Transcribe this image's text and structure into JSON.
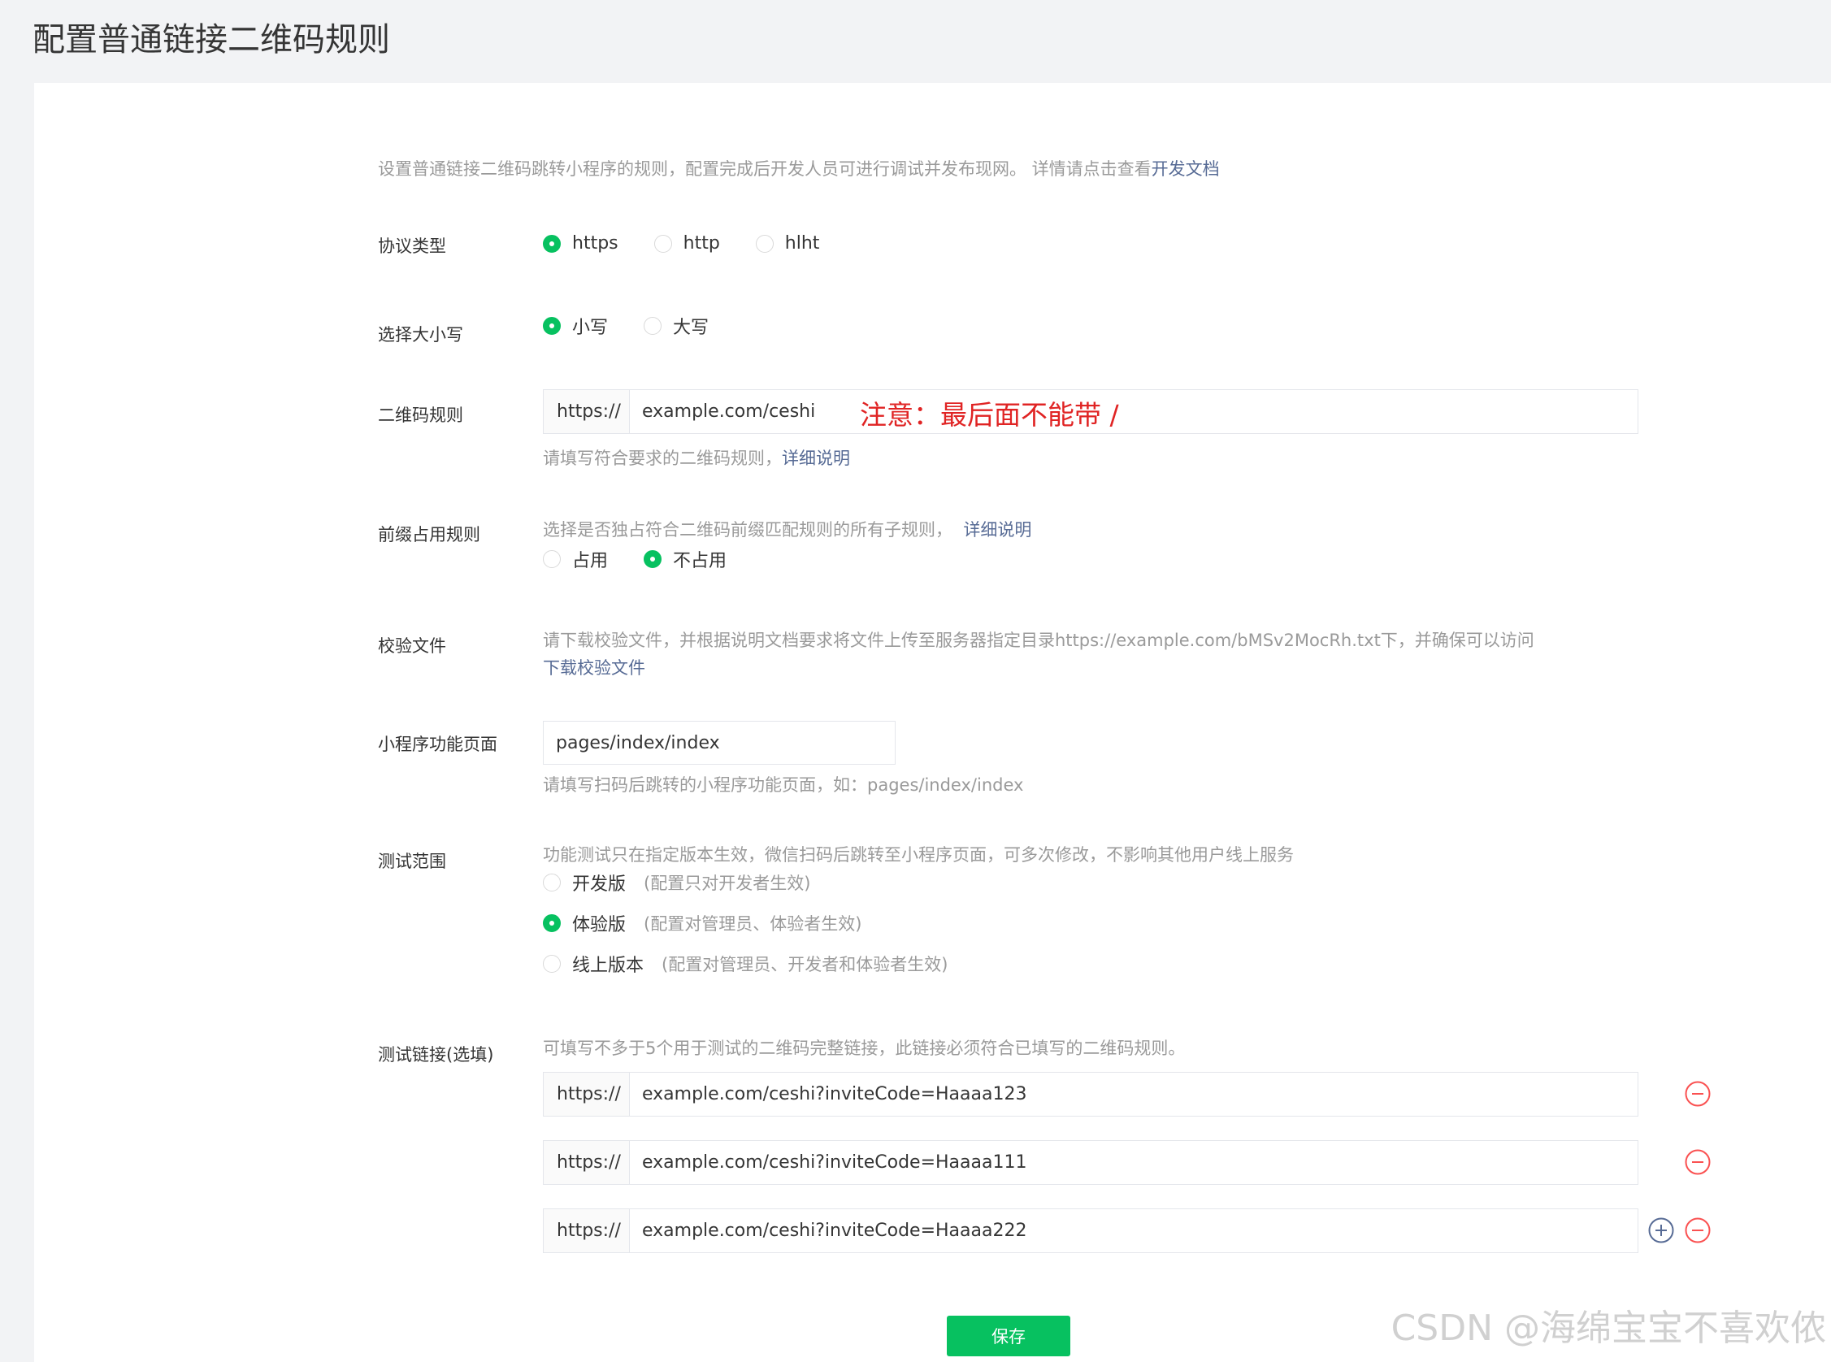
{
  "page_title": "配置普通链接二维码规则",
  "intro": {
    "text": "设置普通链接二维码跳转小程序的规则，配置完成后开发人员可进行调试并发布现网。 详情请点击查看",
    "link": "开发文档"
  },
  "protocol": {
    "label": "协议类型",
    "options": [
      "https",
      "http",
      "hlht"
    ],
    "selected": "https"
  },
  "case": {
    "label": "选择大小写",
    "options": [
      "小写",
      "大写"
    ],
    "selected": "小写"
  },
  "qr_rule": {
    "label": "二维码规则",
    "prefix": "https://",
    "value": "example.com/ceshi",
    "annotation": "注意：最后面不能带 /",
    "hint": "请填写符合要求的二维码规则，",
    "hint_link": "详细说明"
  },
  "prefix_rule": {
    "label": "前缀占用规则",
    "hint": "选择是否独占符合二维码前缀匹配规则的所有子规则，",
    "hint_link": "详细说明",
    "options": [
      "占用",
      "不占用"
    ],
    "selected": "不占用"
  },
  "verify_file": {
    "label": "校验文件",
    "hint": "请下载校验文件，并根据说明文档要求将文件上传至服务器指定目录https://example.com/bMSv2MocRh.txt下，并确保可以访问",
    "download_link": "下载校验文件"
  },
  "mini_page": {
    "label": "小程序功能页面",
    "value": "pages/index/index",
    "hint": "请填写扫码后跳转的小程序功能页面，如：pages/index/index"
  },
  "test_scope": {
    "label": "测试范围",
    "hint": "功能测试只在指定版本生效，微信扫码后跳转至小程序页面，可多次修改，不影响其他用户线上服务",
    "options": [
      {
        "name": "开发版",
        "desc": "(配置只对开发者生效)"
      },
      {
        "name": "体验版",
        "desc": "(配置对管理员、体验者生效)"
      },
      {
        "name": "线上版本",
        "desc": "(配置对管理员、开发者和体验者生效)"
      }
    ],
    "selected": "体验版"
  },
  "test_links": {
    "label": "测试链接(选填)",
    "hint": "可填写不多于5个用于测试的二维码完整链接，此链接必须符合已填写的二维码规则。",
    "prefix": "https://",
    "items": [
      "example.com/ceshi?inviteCode=Haaaa123",
      "example.com/ceshi?inviteCode=Haaaa111",
      "example.com/ceshi?inviteCode=Haaaa222"
    ]
  },
  "save_label": "保存",
  "watermark": "CSDN @海绵宝宝不喜欢侬",
  "colors": {
    "accent": "#07c160",
    "link": "#576b95",
    "remove": "#fa5151",
    "add": "#576b95",
    "annotation": "#e02424"
  }
}
